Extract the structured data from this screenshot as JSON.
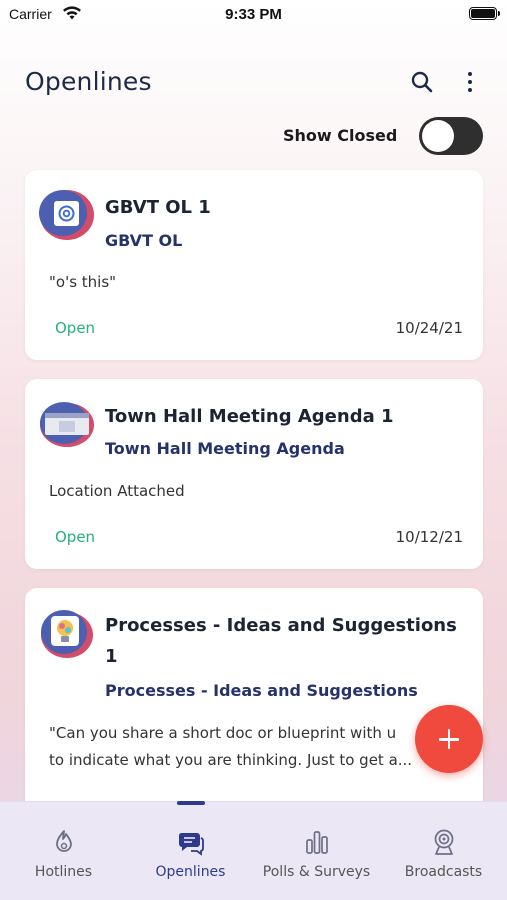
{
  "status_bar": {
    "carrier": "Carrier",
    "time": "9:33 PM"
  },
  "header": {
    "title": "Openlines",
    "search_icon": "search-icon",
    "menu_icon": "more-vertical-icon"
  },
  "filter": {
    "show_closed_label": "Show Closed",
    "show_closed_on": false
  },
  "cards": [
    {
      "name": "GBVT OL 1",
      "group": "GBVT OL",
      "snippet": "\"o's this\"",
      "status": "Open",
      "date": "10/24/21",
      "avatar_icon": "at-sign-icon"
    },
    {
      "name": "Town Hall Meeting Agenda 1",
      "group": "Town Hall Meeting Agenda",
      "snippet": "Location Attached",
      "status": "Open",
      "date": "10/12/21",
      "avatar_icon": "meeting-image-icon"
    },
    {
      "name": "Processes - Ideas and Suggestions 1",
      "group": "Processes - Ideas and Suggestions",
      "snippet_line1": "\"Can you share a short doc or blueprint with u",
      "snippet_line2": "to indicate what you are thinking. Just to get a...",
      "avatar_icon": "lightbulb-icon"
    }
  ],
  "fab": {
    "icon": "plus-icon"
  },
  "tabs": [
    {
      "label": "Hotlines",
      "icon": "flame-icon",
      "active": false
    },
    {
      "label": "Openlines",
      "icon": "chat-bubbles-icon",
      "active": true
    },
    {
      "label": "Polls & Surveys",
      "icon": "bar-chart-icon",
      "active": false
    },
    {
      "label": "Broadcasts",
      "icon": "broadcast-icon",
      "active": false
    }
  ],
  "colors": {
    "accent": "#2e3a8c",
    "open_status": "#23b27a",
    "fab": "#f04a3e",
    "title": "#1f2a4a"
  }
}
